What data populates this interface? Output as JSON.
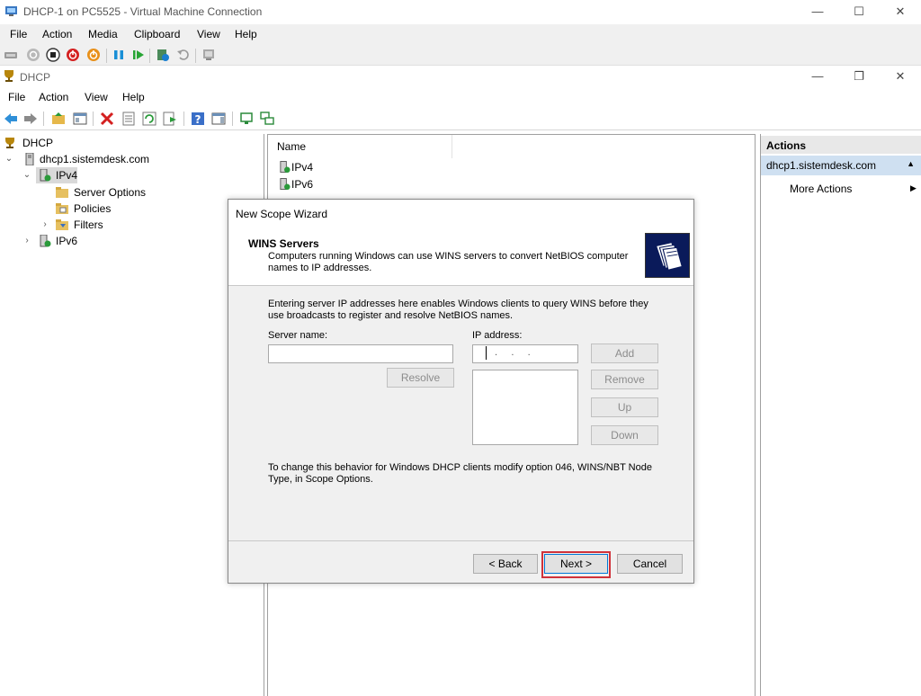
{
  "vm_window": {
    "title": "DHCP-1 on PC5525 - Virtual Machine Connection",
    "menu": [
      "File",
      "Action",
      "Media",
      "Clipboard",
      "View",
      "Help"
    ],
    "controls": {
      "minimize": "—",
      "maximize": "☐",
      "close": "✕"
    }
  },
  "mmc_window": {
    "title": "DHCP",
    "menu": [
      "File",
      "Action",
      "View",
      "Help"
    ],
    "controls": {
      "minimize": "—",
      "restore": "❐",
      "close": "✕"
    }
  },
  "tree": {
    "root": "DHCP",
    "server": "dhcp1.sistemdesk.com",
    "ipv4": "IPv4",
    "server_options": "Server Options",
    "policies": "Policies",
    "filters": "Filters",
    "ipv6": "IPv6"
  },
  "list": {
    "column_header": "Name",
    "rows": [
      "IPv4",
      "IPv6"
    ]
  },
  "actions": {
    "header": "Actions",
    "selected": "dhcp1.sistemdesk.com",
    "more_actions": "More Actions"
  },
  "wizard": {
    "title": "New Scope Wizard",
    "heading": "WINS Servers",
    "subheading": "Computers running Windows can use WINS servers to convert NetBIOS computer names to IP addresses.",
    "intro": "Entering server IP addresses here enables Windows clients to query WINS before they use broadcasts to register and resolve NetBIOS names.",
    "server_name_label": "Server name:",
    "server_name_value": "",
    "ip_label": "IP address:",
    "ip_value": ".     .     .",
    "resolve": "Resolve",
    "add": "Add",
    "remove": "Remove",
    "up": "Up",
    "down": "Down",
    "footer_note": "To change this behavior for Windows DHCP clients modify option 046, WINS/NBT Node Type, in Scope Options.",
    "back": "< Back",
    "next": "Next >",
    "cancel": "Cancel"
  }
}
